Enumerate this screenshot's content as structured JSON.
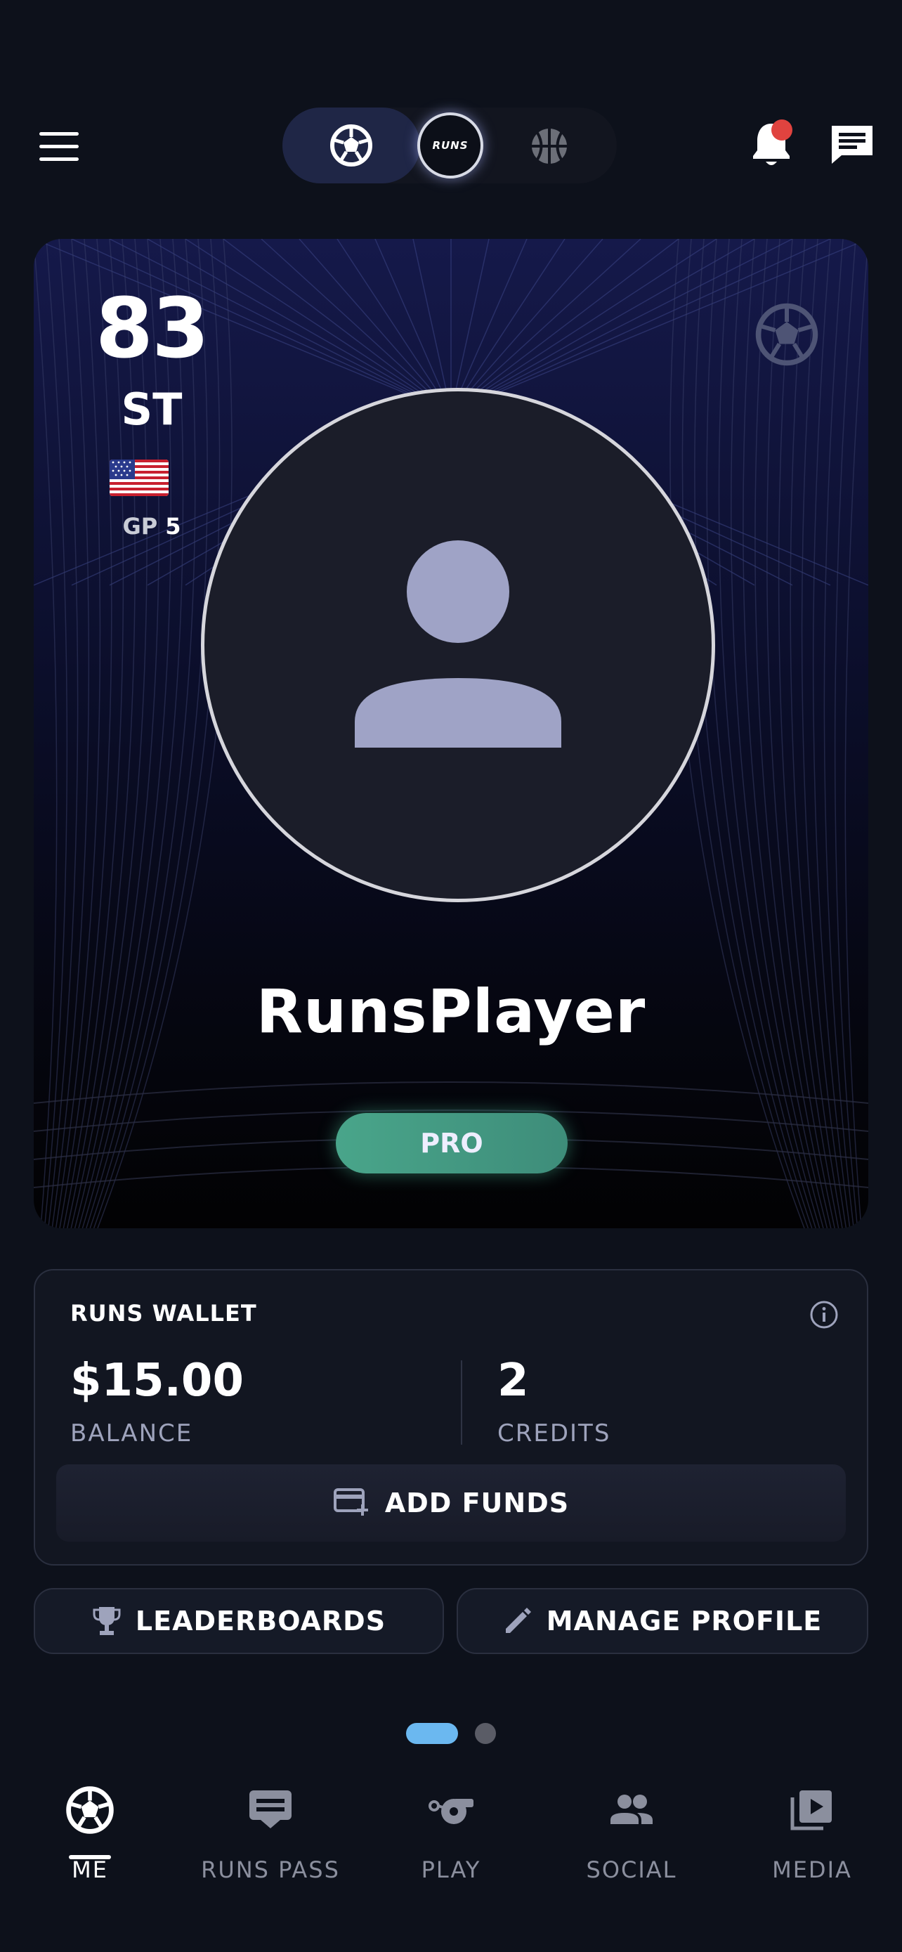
{
  "header": {
    "menu_icon": "hamburger-menu-icon",
    "sport_toggle": {
      "options": [
        "soccer-ball-icon",
        "runs-logo",
        "basketball-icon"
      ],
      "selected": "soccer",
      "logo_text": "RUNS"
    },
    "notification_icon": "bell-icon",
    "notification_dot_color": "#e0433f",
    "messages_icon": "chat-icon"
  },
  "player_card": {
    "rating": "83",
    "position": "ST",
    "flag": "us-flag",
    "gp_label": "GP",
    "gp_value": "5",
    "sport_icon": "soccer-ball-icon",
    "avatar_icon": "person-avatar-icon",
    "name": "RunsPlayer",
    "badge": "PRO",
    "badge_color": "#49a58a"
  },
  "wallet": {
    "title": "RUNS WALLET",
    "info_icon": "info-icon",
    "balance": {
      "value": "$15.00",
      "label": "BALANCE"
    },
    "credits": {
      "value": "2",
      "label": "CREDITS"
    },
    "add_funds": {
      "label": "ADD FUNDS",
      "icon": "card-add-icon"
    }
  },
  "actions": {
    "leaderboards": {
      "label": "LEADERBOARDS",
      "icon": "trophy-icon"
    },
    "manage_profile": {
      "label": "MANAGE PROFILE",
      "icon": "pencil-icon"
    }
  },
  "pager": {
    "pages": 2,
    "active": 1,
    "active_color": "#6bb8f0"
  },
  "bottom_nav": {
    "items": [
      {
        "label": "ME",
        "icon": "soccer-ball-icon",
        "active": true
      },
      {
        "label": "RUNS PASS",
        "icon": "ticket-icon",
        "active": false
      },
      {
        "label": "PLAY",
        "icon": "whistle-icon",
        "active": false
      },
      {
        "label": "SOCIAL",
        "icon": "people-icon",
        "active": false
      },
      {
        "label": "MEDIA",
        "icon": "video-library-icon",
        "active": false
      }
    ]
  }
}
